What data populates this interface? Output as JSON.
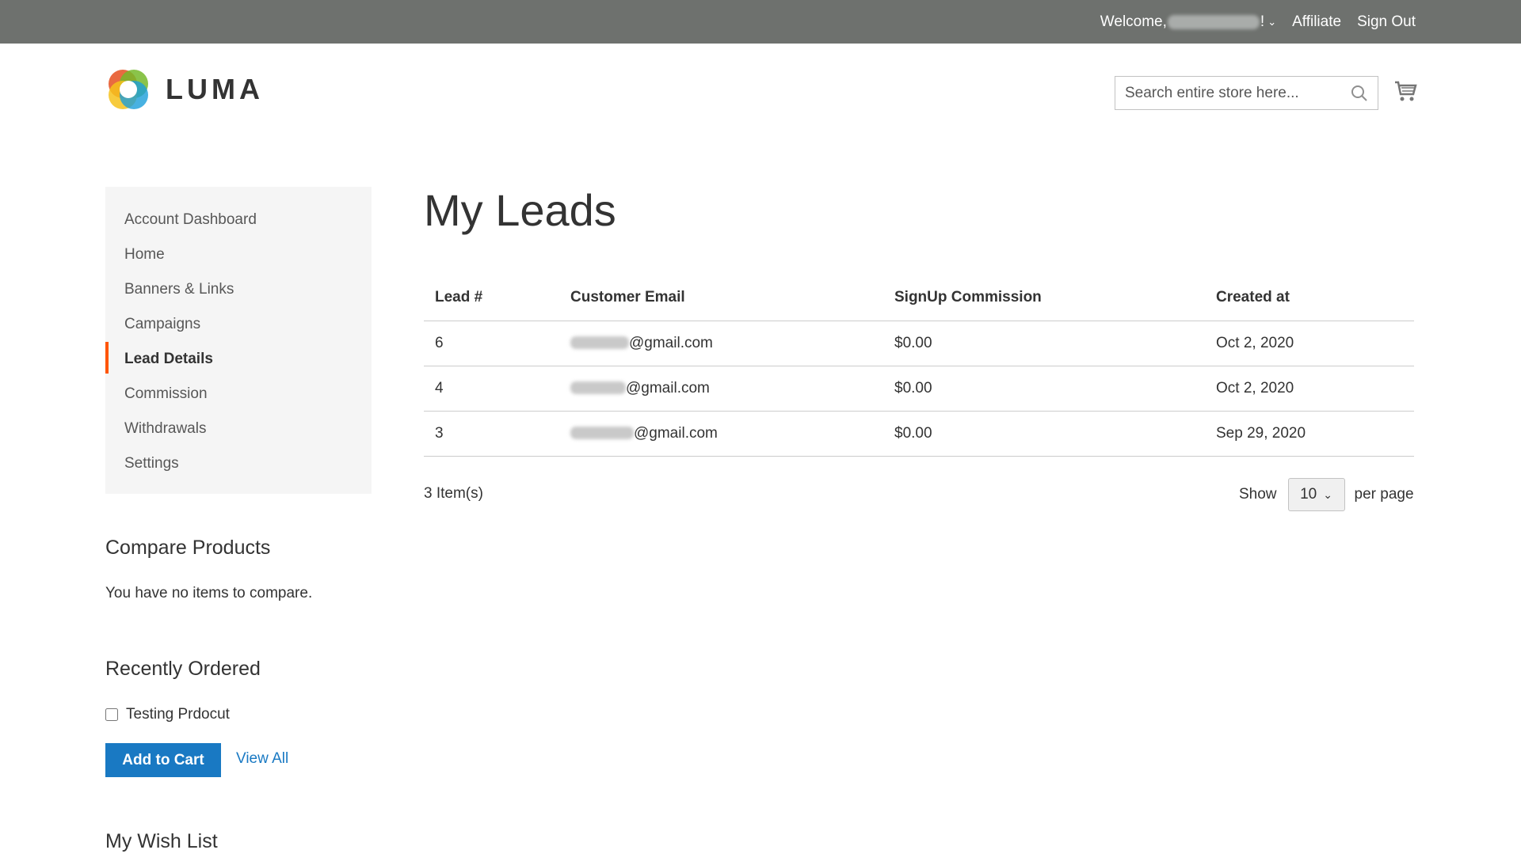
{
  "topbar": {
    "welcome_prefix": "Welcome,",
    "welcome_suffix": "!",
    "affiliate": "Affiliate",
    "sign_out": "Sign Out"
  },
  "header": {
    "logo_text": "LUMA",
    "search_placeholder": "Search entire store here..."
  },
  "sidebar": {
    "items": [
      {
        "label": "Account Dashboard"
      },
      {
        "label": "Home"
      },
      {
        "label": "Banners & Links"
      },
      {
        "label": "Campaigns"
      },
      {
        "label": "Lead Details"
      },
      {
        "label": "Commission"
      },
      {
        "label": "Withdrawals"
      },
      {
        "label": "Settings"
      }
    ],
    "compare_title": "Compare Products",
    "compare_text": "You have no items to compare.",
    "recent_title": "Recently Ordered",
    "recent_item": "Testing Prdocut",
    "add_to_cart": "Add to Cart",
    "view_all": "View All",
    "wishlist_title": "My Wish List"
  },
  "main": {
    "title": "My Leads",
    "columns": [
      "Lead #",
      "Customer Email",
      "SignUp Commission",
      "Created at"
    ],
    "rows": [
      {
        "lead": "6",
        "email_domain": "@gmail.com",
        "commission": "$0.00",
        "created": "Oct 2, 2020"
      },
      {
        "lead": "4",
        "email_domain": "@gmail.com",
        "commission": "$0.00",
        "created": "Oct 2, 2020"
      },
      {
        "lead": "3",
        "email_domain": "@gmail.com",
        "commission": "$0.00",
        "created": "Sep 29, 2020"
      }
    ],
    "item_count": "3 Item(s)",
    "show_label": "Show",
    "per_page_value": "10",
    "per_page_label": "per page"
  }
}
